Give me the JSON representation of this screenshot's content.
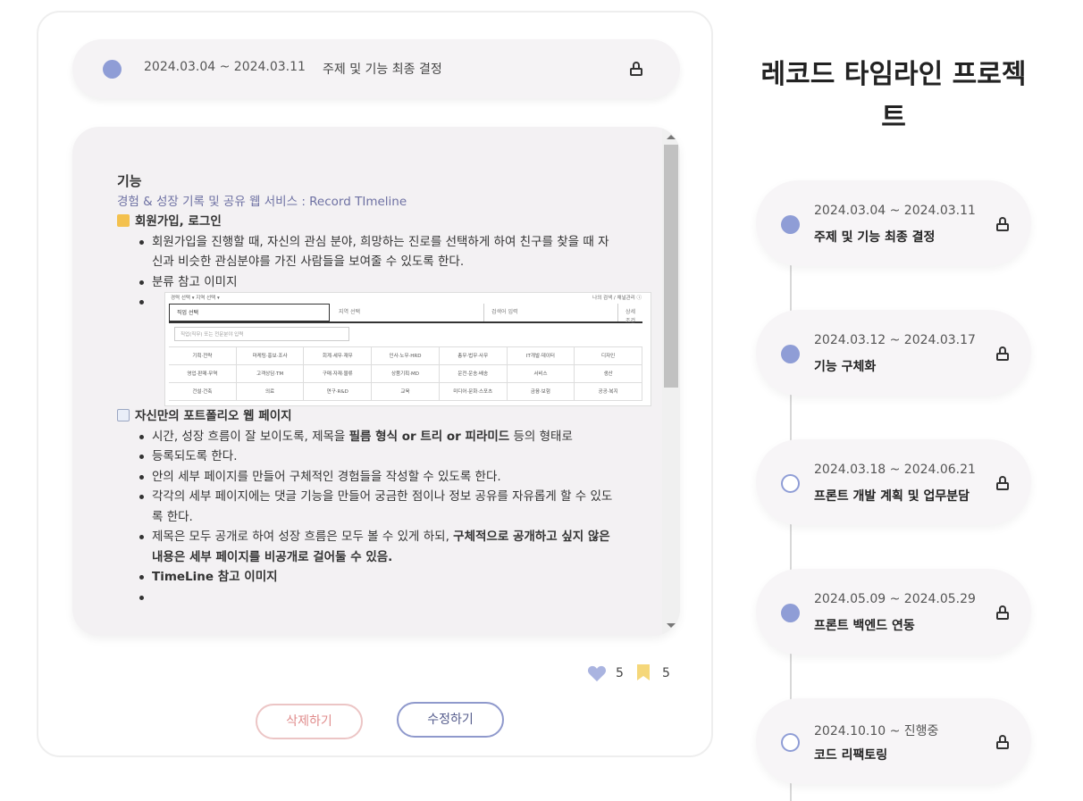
{
  "detail": {
    "date": "2024.03.04 ~ 2024.03.11",
    "title": "주제 및 기능 최종 결정",
    "section_title": "기능",
    "subtitle": "경험 & 성장 기록 및 공유 웹 서비스 : Record TImeline",
    "signup": {
      "header": "회원가입, 로그인",
      "bullet1": "회원가입을 진행할 때, 자신의 관심 분야, 희망하는 진로를 선택하게 하여 친구를 찾을 때 자신과 비슷한 관심분야를 가진 사람들을 보여줄 수 있도록 한다.",
      "bullet2": "분류 참고 이미지"
    },
    "ref_image": {
      "top_left": "경력 선택 ▾   지역 선택 ▾",
      "top_right": "나의 검색 / 채널관리 ⓘ",
      "job_select": "직업 선택",
      "region_select": "지역 선택",
      "search_input": "검색어 입력",
      "detail_btn": "상세조건",
      "job_search": "직업(직무) 또는 전문분야 입력",
      "grid": [
        "기획·전략",
        "마케팅·홍보·조사",
        "회계·세무·재무",
        "인사·노무·HRD",
        "총무·법무·사무",
        "IT개발·데이터",
        "디자인",
        "영업·판매·무역",
        "고객상담·TM",
        "구매·자재·물류",
        "상품기획·MD",
        "운전·운송·배송",
        "서비스",
        "생산",
        "건설·건축",
        "의료",
        "연구·R&D",
        "교육",
        "미디어·문화·스포츠",
        "금융·보험",
        "공공·복지"
      ]
    },
    "portfolio": {
      "header": "자신만의 포트폴리오 웹 페이지",
      "b1_pre": "시간, 성장 흐름이 잘 보이도록, 제목을 ",
      "b1_bold": "필름 형식 or 트리 or 피라미드",
      "b1_post": " 등의 형태로",
      "b2": "등록되도록 한다.",
      "b3": "안의 세부 페이지를 만들어 구체적인 경험들을 작성할 수 있도록 한다.",
      "b4": "각각의 세부 페이지에는 댓글 기능을 만들어 궁금한 점이나 정보 공유를 자유롭게 할 수 있도록 한다.",
      "b5_pre": "제목은 모두 공개로 하여 성장 흐름은 모두 볼 수 있게 하되, ",
      "b5_bold": "구체적으로 공개하고 싶지 않은 내용은 세부 페이지를 비공개로 걸어둘 수 있음.",
      "b6": "TimeLine 참고 이미지"
    },
    "likes": "5",
    "bookmarks": "5",
    "delete_label": "삭제하기",
    "edit_label": "수정하기"
  },
  "sidebar": {
    "title": "레코드 타임라인 프로젝트",
    "items": [
      {
        "date": "2024.03.04 ~ 2024.03.11",
        "title": "주제 및 기능 최종 결정"
      },
      {
        "date": "2024.03.12 ~ 2024.03.17",
        "title": "기능 구체화"
      },
      {
        "date": "2024.03.18 ~ 2024.06.21",
        "title": "프론트 개발 계획 및 업무분담"
      },
      {
        "date": "2024.05.09 ~ 2024.05.29",
        "title": "프론트 백엔드 연동"
      },
      {
        "date": "2024.10.10 ~ 진행중",
        "title": "코드 리팩토링"
      }
    ]
  },
  "colors": {
    "accent": "#8f9dd6",
    "delete": "#e08c8c",
    "bookmark": "#f5d77a"
  }
}
